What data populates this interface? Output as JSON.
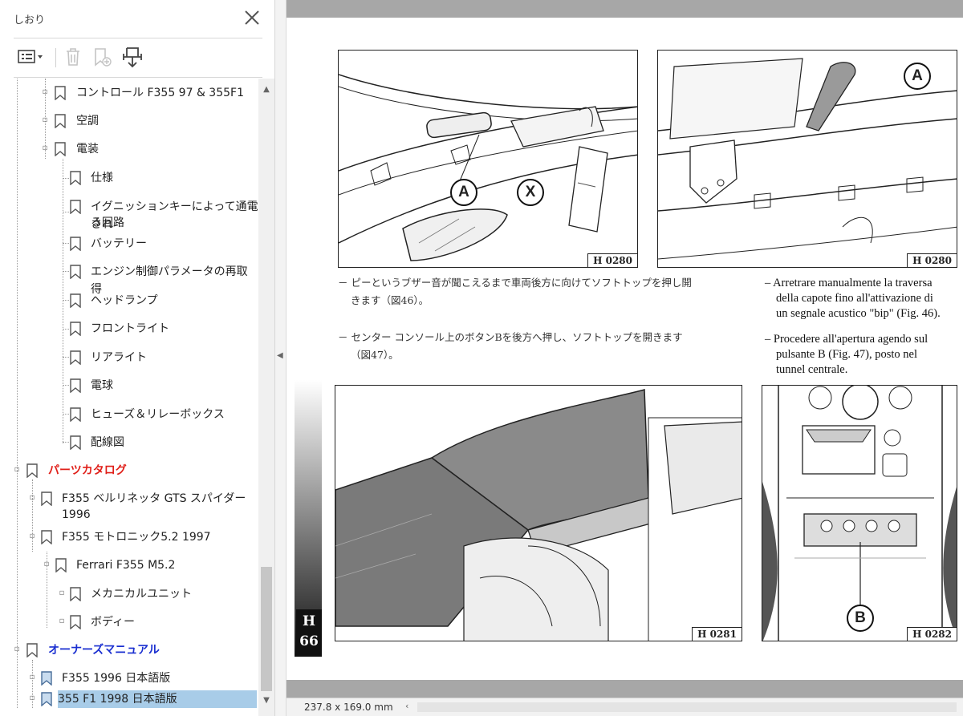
{
  "pane": {
    "title": "しおり",
    "toolbar": {
      "options_icon": "list-options-icon",
      "delete_icon": "trash-icon",
      "new_icon": "new-bookmark-icon",
      "find_icon": "find-bookmark-icon"
    }
  },
  "bookmarks": [
    {
      "label": "コントロール F355 97 & 355F1",
      "style": "normal"
    },
    {
      "label": "空調",
      "style": "normal"
    },
    {
      "label": "電装",
      "style": "normal"
    },
    {
      "label": "仕様",
      "style": "normal"
    },
    {
      "label": "イグニッションキーによって通電され",
      "label2": "る回路",
      "style": "normal"
    },
    {
      "label": "バッテリー",
      "style": "normal"
    },
    {
      "label": "エンジン制御パラメータの再取得",
      "style": "normal"
    },
    {
      "label": "ヘッドランプ",
      "style": "normal"
    },
    {
      "label": "フロントライト",
      "style": "normal"
    },
    {
      "label": "リアライト",
      "style": "normal"
    },
    {
      "label": "電球",
      "style": "normal"
    },
    {
      "label": "ヒューズ＆リレーボックス",
      "style": "normal"
    },
    {
      "label": "配線図",
      "style": "normal"
    },
    {
      "label": "パーツカタログ",
      "style": "red"
    },
    {
      "label": "F355 ベルリネッタ GTS スパイダー",
      "label2": "1996",
      "style": "normal"
    },
    {
      "label": "F355 モトロニック5.2 1997",
      "style": "normal"
    },
    {
      "label": "Ferrari F355 M5.2",
      "style": "normal"
    },
    {
      "label": "メカニカルユニット",
      "style": "normal"
    },
    {
      "label": "ボディー",
      "style": "normal"
    },
    {
      "label": "オーナーズマニュアル",
      "style": "blue"
    },
    {
      "label": "F355 1996 日本語版",
      "style": "normal"
    },
    {
      "label": "355 F1 1998 日本語版",
      "style": "normal",
      "selected": true
    }
  ],
  "document": {
    "figures": {
      "fig46_code": "H 0280",
      "fig47_code": "H 0280",
      "fig_a_code": "H 0281",
      "fig_b_code": "H 0282",
      "callout_a": "A",
      "callout_x": "X",
      "callout_b": "B"
    },
    "jp_step1": "－ ピーというブザー音が聞こえるまで車両後方に向けてソフトトップを押し開",
    "jp_step1b": "きます（図46）。",
    "jp_step2": "－ センター コンソール上のボタンBを後方へ押し、ソフトトップを開きます",
    "jp_step2b": "（図47）。",
    "it_step1_l1": "– Arretrare manualmente la traversa",
    "it_step1_l2": "della capote fino all'attivazione di",
    "it_step1_l3": "un segnale acustico \"bip\" (Fig. 46).",
    "it_step2_l1": "– Procedere all'apertura agendo sul",
    "it_step2_l2": "pulsante B (Fig. 47), posto nel",
    "it_step2_l3": "tunnel centrale.",
    "section_letter": "H",
    "page_number": "66"
  },
  "status": {
    "page_size": "237.8 x 169.0 mm"
  }
}
